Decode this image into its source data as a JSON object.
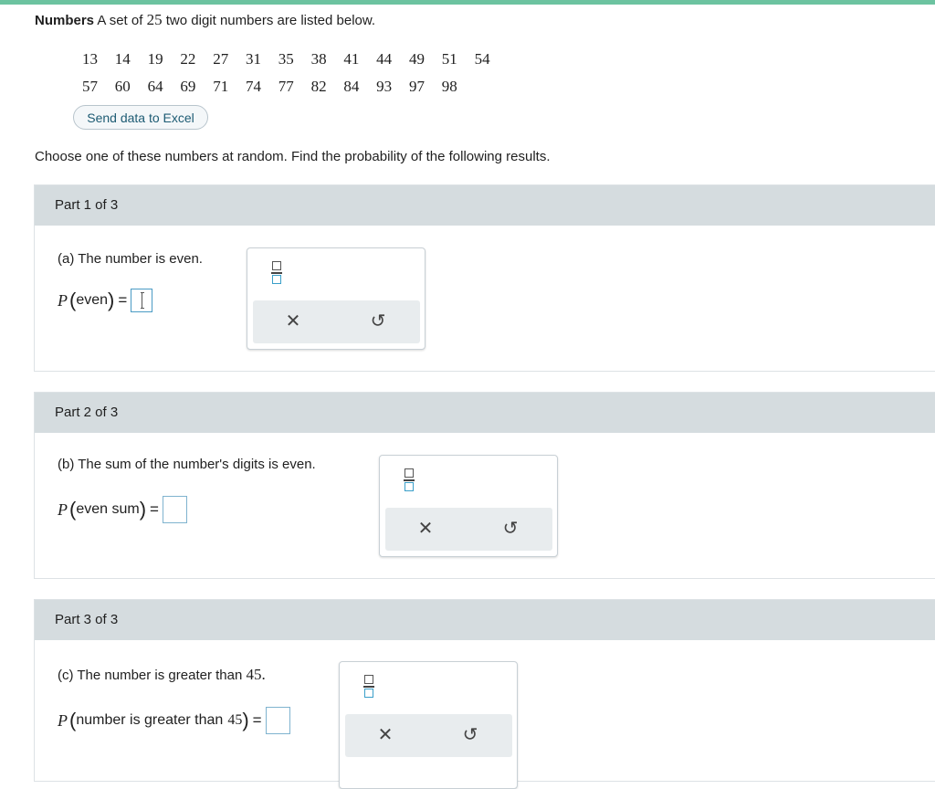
{
  "problem": {
    "title": "Numbers",
    "intro_before": "A set of",
    "count": "25",
    "intro_after": "two digit numbers are listed below.",
    "numbers_row1": [
      "13",
      "14",
      "19",
      "22",
      "27",
      "31",
      "35",
      "38",
      "41",
      "44",
      "49",
      "51",
      "54"
    ],
    "numbers_row2": [
      "57",
      "60",
      "64",
      "69",
      "71",
      "74",
      "77",
      "82",
      "84",
      "93",
      "97",
      "98"
    ],
    "excel_button": "Send data to Excel",
    "question": "Choose one of these numbers at random. Find the probability of the following results."
  },
  "parts": [
    {
      "header": "Part 1 of 3",
      "label": "(a) The number is even.",
      "p": "P",
      "arg": "even",
      "eq": "="
    },
    {
      "header": "Part 2 of 3",
      "label": "(b) The sum of the number's digits is even.",
      "p": "P",
      "arg": "even sum",
      "eq": "="
    },
    {
      "header": "Part 3 of 3",
      "label_text": "(c) The number is greater than",
      "label_num": "45.",
      "p": "P",
      "arg_text": "number is greater than",
      "arg_num": "45",
      "eq": "="
    }
  ],
  "palette": {
    "fraction_icon": "fraction-icon",
    "clear_glyph": "✕",
    "undo_glyph": "↺"
  },
  "colors": {
    "top_bar": "#6cc3a0",
    "part_header": "#d5dcdf",
    "answer_box_border": "#7fb3cf",
    "link_text": "#1d5b73"
  }
}
